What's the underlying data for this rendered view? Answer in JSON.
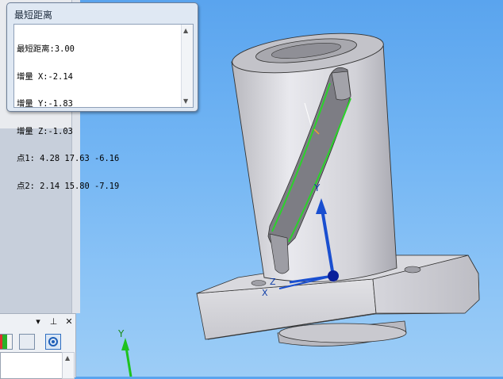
{
  "measure_window": {
    "title": "最短距离",
    "lines": [
      "最短距离:3.00",
      "增量 X:-2.14",
      "增量 Y:-1.83",
      "增量 Z:-1.03",
      "点1: 4.28 17.63 -6.16",
      "点2: 2.14 15.80 -7.19"
    ]
  },
  "triad_main": {
    "y_label": "Y",
    "x_label": "X",
    "z_label": "Z"
  },
  "triad_corner": {
    "y_label": "Y"
  },
  "dock_panel": {
    "icons": [
      "color-swatch-icon",
      "display-manager-icon",
      "settings-gear-icon"
    ]
  },
  "colors": {
    "highlight": "#2ad32a",
    "axis_blue": "#1a4fd0",
    "axis_green": "#1ec21e"
  }
}
